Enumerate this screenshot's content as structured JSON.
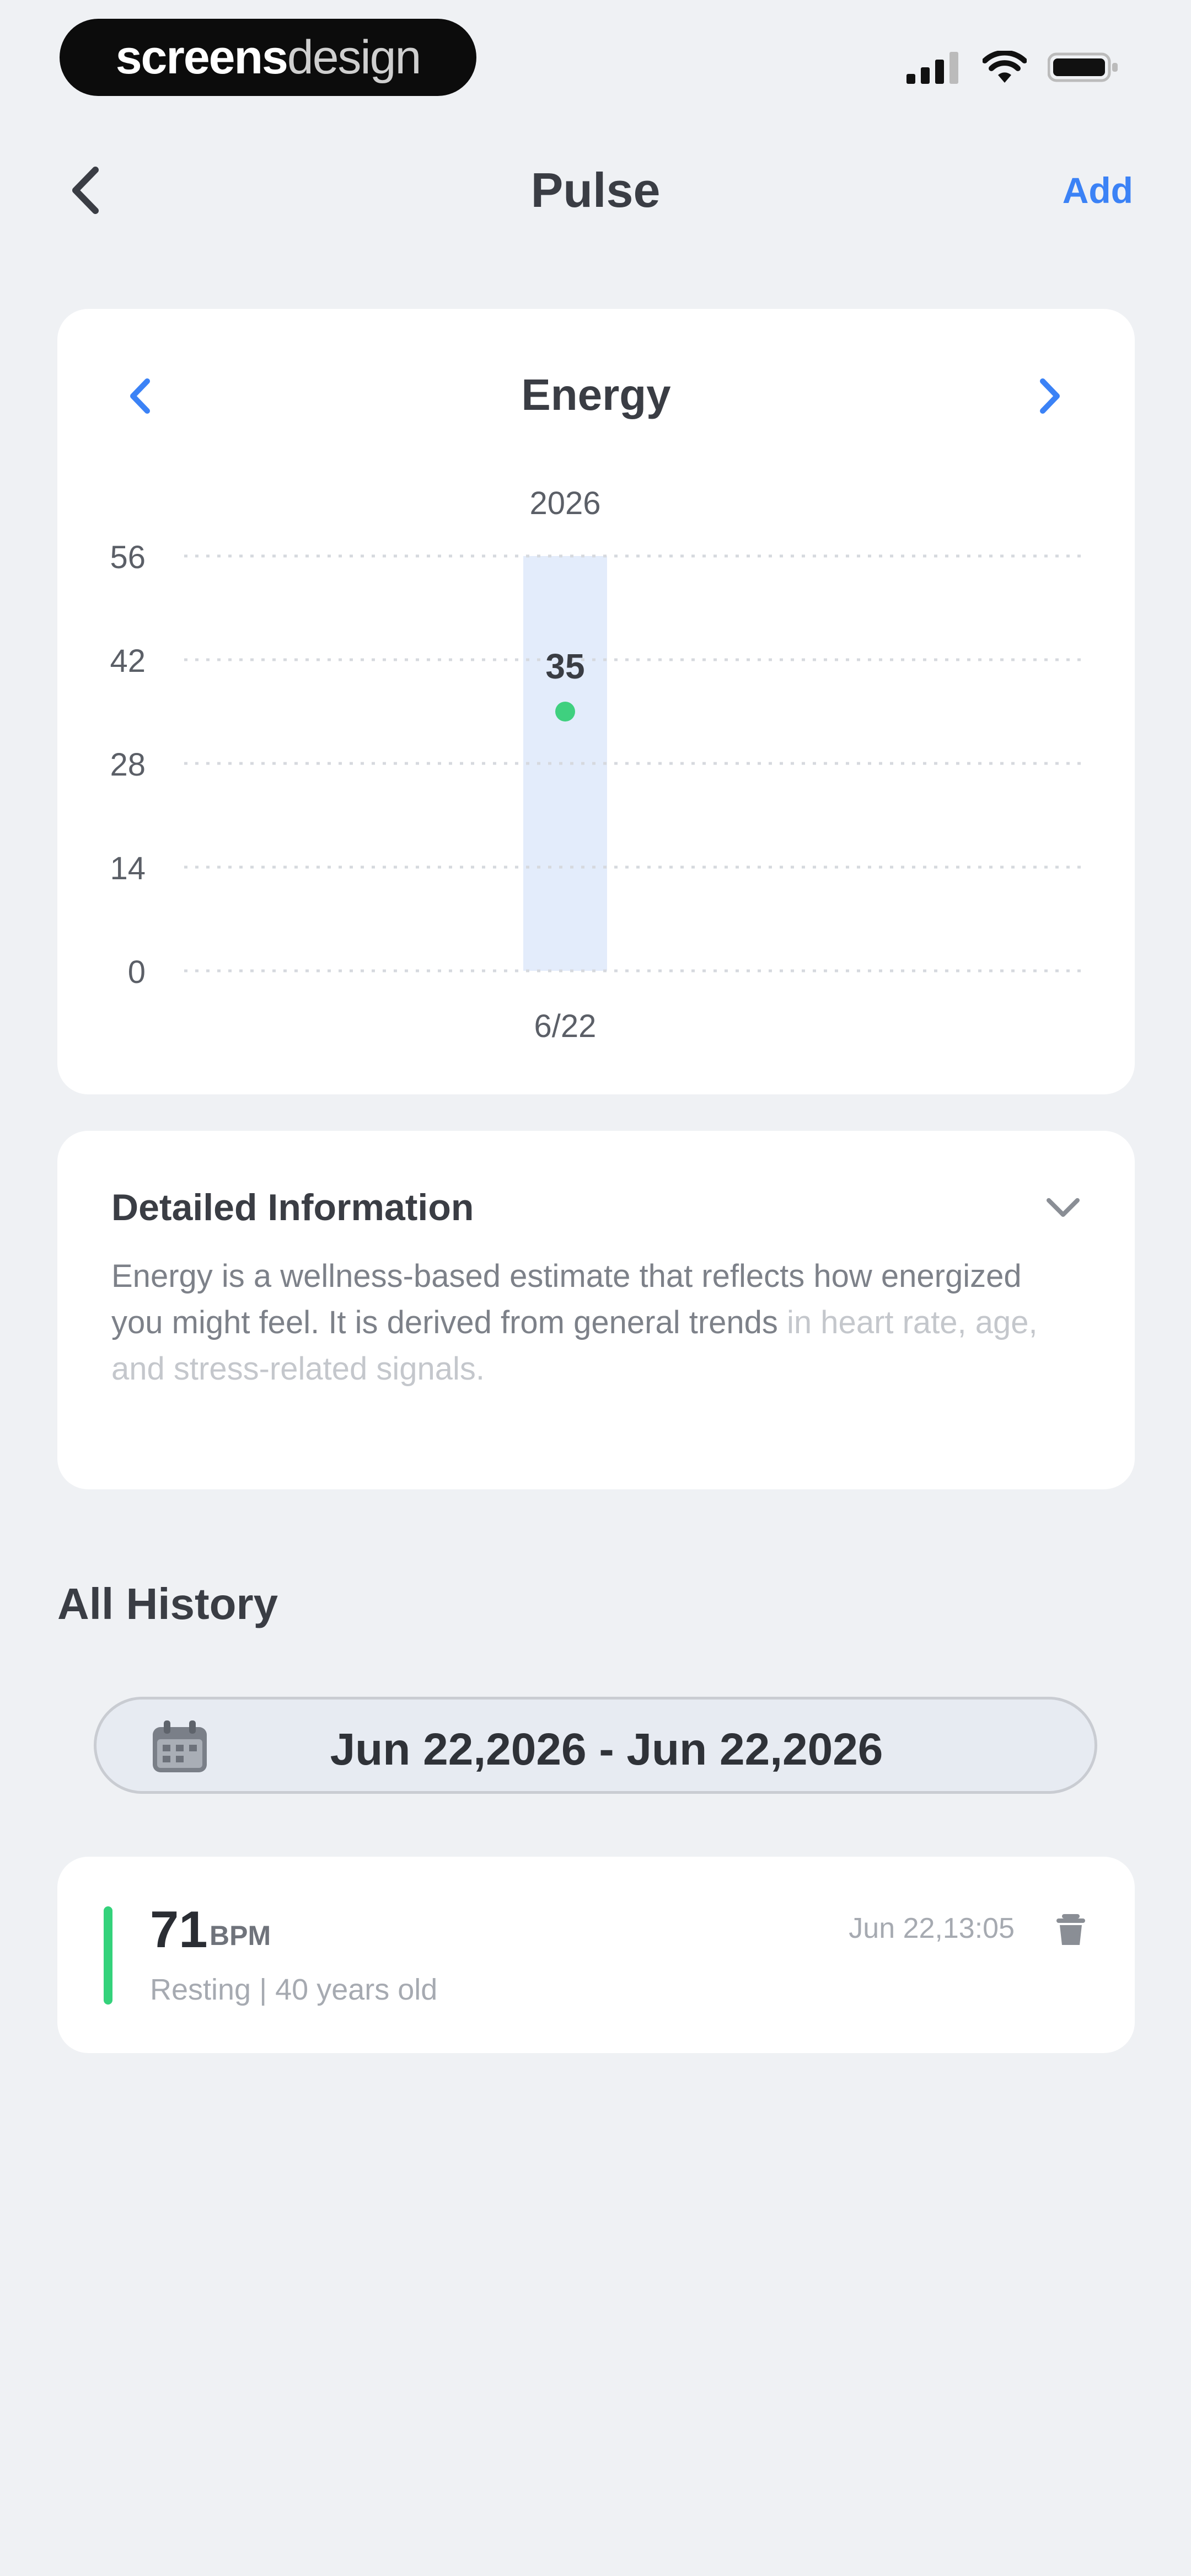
{
  "status_bar": {
    "brand_a": "screens",
    "brand_b": "design",
    "icons": [
      "signal-icon",
      "wifi-icon",
      "battery-icon"
    ]
  },
  "nav": {
    "back_icon": "chevron-left-icon",
    "title": "Pulse",
    "add_label": "Add"
  },
  "chart_card": {
    "title": "Energy",
    "prev_icon": "chevron-left-icon",
    "next_icon": "chevron-right-icon"
  },
  "chart_data": {
    "type": "bar",
    "title": "Energy",
    "year_label": "2026",
    "categories": [
      "6/22"
    ],
    "values": [
      35
    ],
    "ylim": [
      0,
      56
    ],
    "yticks": [
      56,
      42,
      28,
      14,
      0
    ],
    "grid": true,
    "colors": {
      "bar": "#e3ecfb",
      "point": "#3fd07f",
      "grid": "#d6d9de"
    }
  },
  "info": {
    "title": "Detailed Information",
    "body": "Energy is a wellness-based estimate that reflects how energized you might feel. It is derived from general trends",
    "body_faded": "in heart rate, age, and stress-related signals."
  },
  "history": {
    "heading": "All History",
    "date_range": "Jun 22,2026 - Jun 22,2026",
    "items": [
      {
        "value": "71",
        "unit": "BPM",
        "subtitle": "Resting | 40 years old",
        "time": "Jun 22,13:05"
      }
    ]
  }
}
